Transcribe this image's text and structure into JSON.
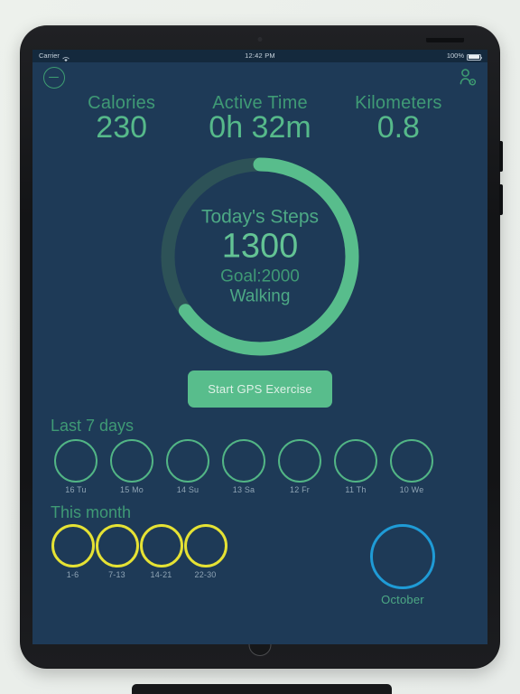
{
  "status_bar": {
    "carrier": "Carrier",
    "wifi_icon": "wifi-icon",
    "time": "12:42 PM",
    "battery_percent": "100%",
    "battery_icon": "battery-icon"
  },
  "app_header": {
    "menu_icon": "menu-circle-icon",
    "profile_icon": "user-settings-icon"
  },
  "stats": [
    {
      "label": "Calories",
      "value": "230"
    },
    {
      "label": "Active Time",
      "value": "0h 32m"
    },
    {
      "label": "Kilometers",
      "value": "0.8"
    }
  ],
  "ring": {
    "title": "Today's Steps",
    "steps": "1300",
    "goal": "Goal:2000",
    "mode": "Walking",
    "progress_percent": 65,
    "track_color": "#2d5257",
    "progress_color": "#58bd8c"
  },
  "gps_button": {
    "label": "Start GPS Exercise",
    "color": "#58bd8c"
  },
  "last_7_days": {
    "title": "Last 7 days",
    "ring_color": "#52b585",
    "days": [
      {
        "label": "16 Tu"
      },
      {
        "label": "15 Mo"
      },
      {
        "label": "14 Su"
      },
      {
        "label": "13 Sa"
      },
      {
        "label": "12 Fr"
      },
      {
        "label": "11 Th"
      },
      {
        "label": "10 We"
      }
    ]
  },
  "this_month": {
    "title": "This month",
    "ring_color": "#e5e234",
    "weeks": [
      {
        "label": "1-6"
      },
      {
        "label": "7-13"
      },
      {
        "label": "14-21"
      },
      {
        "label": "22-30"
      }
    ],
    "month": {
      "label": "October",
      "ring_color": "#1f9bd6"
    }
  },
  "device": {
    "home_button": "home-button",
    "front_camera": "front-camera"
  },
  "theme": {
    "screen_bg": "#1e3a57",
    "status_bg": "#14293d",
    "accent_green": "#56b98a",
    "muted_green": "#3f9a75"
  }
}
